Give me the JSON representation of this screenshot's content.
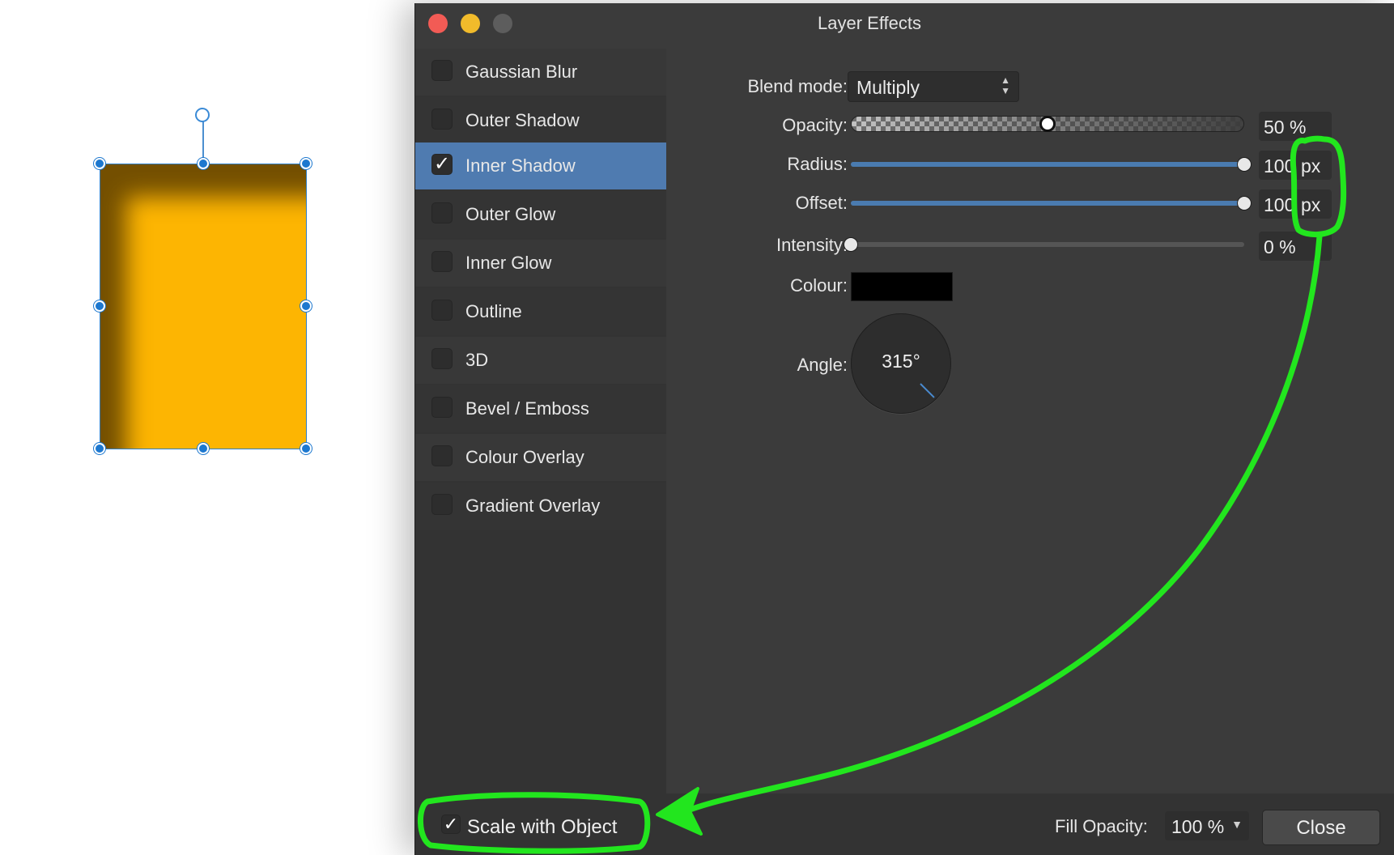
{
  "canvas": {
    "shape_fill": "#fdb502",
    "handle_color": "#1d78cf"
  },
  "dialog": {
    "title": "Layer Effects",
    "effects": [
      {
        "label": "Gaussian Blur",
        "checked": false
      },
      {
        "label": "Outer Shadow",
        "checked": false
      },
      {
        "label": "Inner Shadow",
        "checked": true
      },
      {
        "label": "Outer Glow",
        "checked": false
      },
      {
        "label": "Inner Glow",
        "checked": false
      },
      {
        "label": "Outline",
        "checked": false
      },
      {
        "label": "3D",
        "checked": false
      },
      {
        "label": "Bevel / Emboss",
        "checked": false
      },
      {
        "label": "Colour Overlay",
        "checked": false
      },
      {
        "label": "Gradient Overlay",
        "checked": false
      }
    ],
    "properties": {
      "blend_mode_label": "Blend mode:",
      "blend_mode_value": "Multiply",
      "opacity_label": "Opacity:",
      "opacity_value": "50 %",
      "opacity_level": 0.5,
      "radius_label": "Radius:",
      "radius_value": "100",
      "radius_unit": "px",
      "radius_level": 1.0,
      "offset_label": "Offset:",
      "offset_value": "100",
      "offset_unit": "px",
      "offset_level": 1.0,
      "intensity_label": "Intensity:",
      "intensity_value": "0 %",
      "intensity_level": 0.0,
      "colour_label": "Colour:",
      "colour_value": "#000000",
      "angle_label": "Angle:",
      "angle_value": "315°"
    },
    "bottom": {
      "scale_with_object_label": "Scale with Object",
      "scale_with_object_checked": true,
      "fill_opacity_label": "Fill Opacity:",
      "fill_opacity_value": "100 %",
      "close_label": "Close"
    }
  },
  "annotation": {
    "color": "#22e61e"
  }
}
